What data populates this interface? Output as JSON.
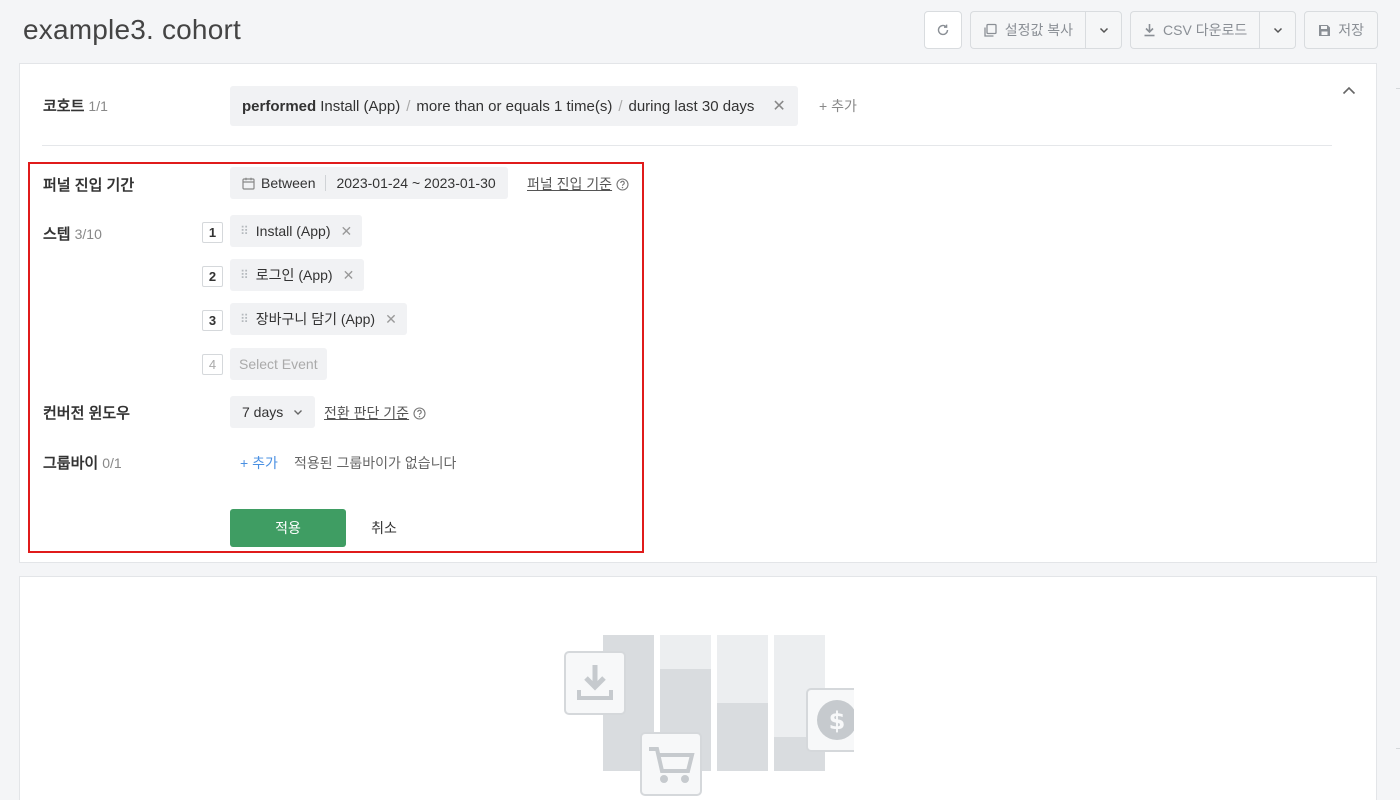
{
  "header": {
    "title": "example3. cohort",
    "copy_settings_label": "설정값 복사",
    "csv_download_label": "CSV 다운로드",
    "save_label": "저장"
  },
  "cohort": {
    "label": "코호트",
    "count": "1/1",
    "performed": "performed",
    "event": "Install (App)",
    "condition": "more than or equals 1 time(s)",
    "period": "during last 30 days",
    "add_label": "+ 추가"
  },
  "funnel_period": {
    "label": "퍼널 진입 기간",
    "mode": "Between",
    "range": "2023-01-24 ~ 2023-01-30",
    "help_link": "퍼널 진입 기준"
  },
  "steps": {
    "label": "스텝",
    "count": "3/10",
    "items": [
      {
        "num": "1",
        "label": "Install (App)"
      },
      {
        "num": "2",
        "label": "로그인 (App)"
      },
      {
        "num": "3",
        "label": "장바구니 담기 (App)"
      }
    ],
    "next_num": "4",
    "placeholder": "Select Event"
  },
  "conversion_window": {
    "label": "컨버전 윈도우",
    "value": "7 days",
    "help_link": "전환 판단 기준"
  },
  "groupby": {
    "label": "그룹바이",
    "count": "0/1",
    "add_label": "+ 추가",
    "empty_text": "적용된 그룹바이가 없습니다"
  },
  "actions": {
    "apply_label": "적용",
    "cancel_label": "취소"
  },
  "colors": {
    "apply": "#3f9d63",
    "highlight": "#e01b1b",
    "link": "#4a90e2"
  }
}
